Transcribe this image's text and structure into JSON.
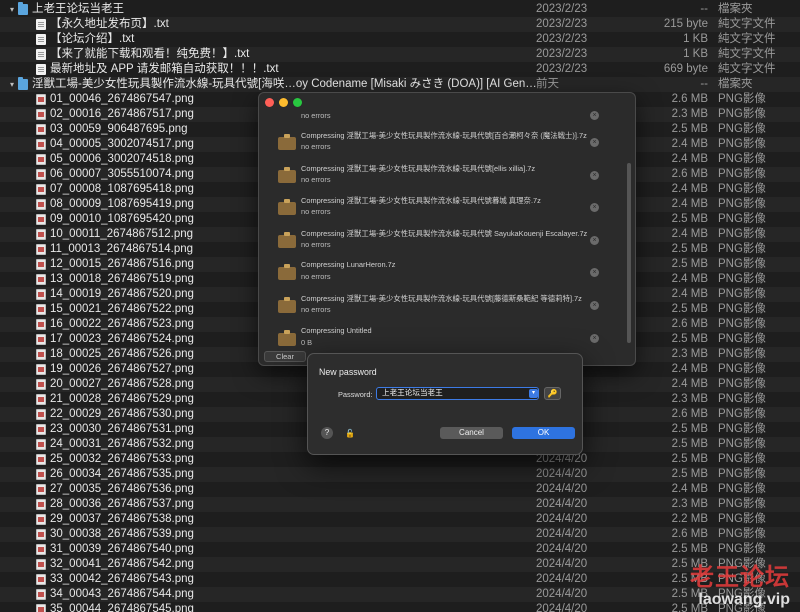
{
  "finder": {
    "rows": [
      {
        "disclosure": "▾",
        "icon": "folder",
        "indent": 0,
        "name": "上老王论坛当老王",
        "date": "2023/2/23",
        "size": "--",
        "kind": "檔案夾"
      },
      {
        "disclosure": "",
        "icon": "doc",
        "indent": 1,
        "name": "【永久地址发布页】.txt",
        "date": "2023/2/23",
        "size": "215 byte",
        "kind": "純文字文件"
      },
      {
        "disclosure": "",
        "icon": "doc",
        "indent": 1,
        "name": "【论坛介绍】.txt",
        "date": "2023/2/23",
        "size": "1 KB",
        "kind": "純文字文件"
      },
      {
        "disclosure": "",
        "icon": "doc",
        "indent": 1,
        "name": "【来了就能下载和观看！纯免费！】.txt",
        "date": "2023/2/23",
        "size": "1 KB",
        "kind": "純文字文件"
      },
      {
        "disclosure": "",
        "icon": "doc",
        "indent": 1,
        "name": "最新地址及 APP 请发邮箱自动获取！！！.txt",
        "date": "2023/2/23",
        "size": "669 byte",
        "kind": "純文字文件"
      },
      {
        "disclosure": "▾",
        "icon": "folder",
        "indent": 0,
        "name": "淫獸工場-美少女性玩具製作流水線-玩具代號[海咲…oy Codename [Misaki みさき (DOA)] [AI Generated]",
        "date": "前天",
        "size": "--",
        "kind": "檔案夾"
      },
      {
        "disclosure": "",
        "icon": "img",
        "indent": 1,
        "name": "01_00046_2674867547.png",
        "date": "",
        "size": "2.6 MB",
        "kind": "PNG影像"
      },
      {
        "disclosure": "",
        "icon": "img",
        "indent": 1,
        "name": "02_00016_2674867517.png",
        "date": "",
        "size": "2.3 MB",
        "kind": "PNG影像"
      },
      {
        "disclosure": "",
        "icon": "img",
        "indent": 1,
        "name": "03_00059_906487695.png",
        "date": "",
        "size": "2.5 MB",
        "kind": "PNG影像"
      },
      {
        "disclosure": "",
        "icon": "img",
        "indent": 1,
        "name": "04_00005_3002074517.png",
        "date": "",
        "size": "2.4 MB",
        "kind": "PNG影像"
      },
      {
        "disclosure": "",
        "icon": "img",
        "indent": 1,
        "name": "05_00006_3002074518.png",
        "date": "",
        "size": "2.4 MB",
        "kind": "PNG影像"
      },
      {
        "disclosure": "",
        "icon": "img",
        "indent": 1,
        "name": "06_00007_3055510074.png",
        "date": "",
        "size": "2.6 MB",
        "kind": "PNG影像"
      },
      {
        "disclosure": "",
        "icon": "img",
        "indent": 1,
        "name": "07_00008_1087695418.png",
        "date": "",
        "size": "2.4 MB",
        "kind": "PNG影像"
      },
      {
        "disclosure": "",
        "icon": "img",
        "indent": 1,
        "name": "08_00009_1087695419.png",
        "date": "",
        "size": "2.4 MB",
        "kind": "PNG影像"
      },
      {
        "disclosure": "",
        "icon": "img",
        "indent": 1,
        "name": "09_00010_1087695420.png",
        "date": "",
        "size": "2.5 MB",
        "kind": "PNG影像"
      },
      {
        "disclosure": "",
        "icon": "img",
        "indent": 1,
        "name": "10_00011_2674867512.png",
        "date": "",
        "size": "2.4 MB",
        "kind": "PNG影像"
      },
      {
        "disclosure": "",
        "icon": "img",
        "indent": 1,
        "name": "11_00013_2674867514.png",
        "date": "",
        "size": "2.5 MB",
        "kind": "PNG影像"
      },
      {
        "disclosure": "",
        "icon": "img",
        "indent": 1,
        "name": "12_00015_2674867516.png",
        "date": "",
        "size": "2.5 MB",
        "kind": "PNG影像"
      },
      {
        "disclosure": "",
        "icon": "img",
        "indent": 1,
        "name": "13_00018_2674867519.png",
        "date": "",
        "size": "2.4 MB",
        "kind": "PNG影像"
      },
      {
        "disclosure": "",
        "icon": "img",
        "indent": 1,
        "name": "14_00019_2674867520.png",
        "date": "",
        "size": "2.4 MB",
        "kind": "PNG影像"
      },
      {
        "disclosure": "",
        "icon": "img",
        "indent": 1,
        "name": "15_00021_2674867522.png",
        "date": "",
        "size": "2.5 MB",
        "kind": "PNG影像"
      },
      {
        "disclosure": "",
        "icon": "img",
        "indent": 1,
        "name": "16_00022_2674867523.png",
        "date": "",
        "size": "2.6 MB",
        "kind": "PNG影像"
      },
      {
        "disclosure": "",
        "icon": "img",
        "indent": 1,
        "name": "17_00023_2674867524.png",
        "date": "",
        "size": "2.5 MB",
        "kind": "PNG影像"
      },
      {
        "disclosure": "",
        "icon": "img",
        "indent": 1,
        "name": "18_00025_2674867526.png",
        "date": "",
        "size": "2.3 MB",
        "kind": "PNG影像"
      },
      {
        "disclosure": "",
        "icon": "img",
        "indent": 1,
        "name": "19_00026_2674867527.png",
        "date": "",
        "size": "2.4 MB",
        "kind": "PNG影像"
      },
      {
        "disclosure": "",
        "icon": "img",
        "indent": 1,
        "name": "20_00027_2674867528.png",
        "date": "",
        "size": "2.4 MB",
        "kind": "PNG影像"
      },
      {
        "disclosure": "",
        "icon": "img",
        "indent": 1,
        "name": "21_00028_2674867529.png",
        "date": "",
        "size": "2.3 MB",
        "kind": "PNG影像"
      },
      {
        "disclosure": "",
        "icon": "img",
        "indent": 1,
        "name": "22_00029_2674867530.png",
        "date": "",
        "size": "2.6 MB",
        "kind": "PNG影像"
      },
      {
        "disclosure": "",
        "icon": "img",
        "indent": 1,
        "name": "23_00030_2674867531.png",
        "date": "",
        "size": "2.5 MB",
        "kind": "PNG影像"
      },
      {
        "disclosure": "",
        "icon": "img",
        "indent": 1,
        "name": "24_00031_2674867532.png",
        "date": "",
        "size": "2.5 MB",
        "kind": "PNG影像"
      },
      {
        "disclosure": "",
        "icon": "img",
        "indent": 1,
        "name": "25_00032_2674867533.png",
        "date": "2024/4/20",
        "size": "2.5 MB",
        "kind": "PNG影像"
      },
      {
        "disclosure": "",
        "icon": "img",
        "indent": 1,
        "name": "26_00034_2674867535.png",
        "date": "2024/4/20",
        "size": "2.5 MB",
        "kind": "PNG影像"
      },
      {
        "disclosure": "",
        "icon": "img",
        "indent": 1,
        "name": "27_00035_2674867536.png",
        "date": "2024/4/20",
        "size": "2.4 MB",
        "kind": "PNG影像"
      },
      {
        "disclosure": "",
        "icon": "img",
        "indent": 1,
        "name": "28_00036_2674867537.png",
        "date": "2024/4/20",
        "size": "2.3 MB",
        "kind": "PNG影像"
      },
      {
        "disclosure": "",
        "icon": "img",
        "indent": 1,
        "name": "29_00037_2674867538.png",
        "date": "2024/4/20",
        "size": "2.2 MB",
        "kind": "PNG影像"
      },
      {
        "disclosure": "",
        "icon": "img",
        "indent": 1,
        "name": "30_00038_2674867539.png",
        "date": "2024/4/20",
        "size": "2.6 MB",
        "kind": "PNG影像"
      },
      {
        "disclosure": "",
        "icon": "img",
        "indent": 1,
        "name": "31_00039_2674867540.png",
        "date": "2024/4/20",
        "size": "2.5 MB",
        "kind": "PNG影像"
      },
      {
        "disclosure": "",
        "icon": "img",
        "indent": 1,
        "name": "32_00041_2674867542.png",
        "date": "2024/4/20",
        "size": "2.5 MB",
        "kind": "PNG影像"
      },
      {
        "disclosure": "",
        "icon": "img",
        "indent": 1,
        "name": "33_00042_2674867543.png",
        "date": "2024/4/20",
        "size": "2.5 MB",
        "kind": "PNG影像"
      },
      {
        "disclosure": "",
        "icon": "img",
        "indent": 1,
        "name": "34_00043_2674867544.png",
        "date": "2024/4/20",
        "size": "2.5 MB",
        "kind": "PNG影像"
      },
      {
        "disclosure": "",
        "icon": "img",
        "indent": 1,
        "name": "35_00044_2674867545.png",
        "date": "2024/4/20",
        "size": "2.5 MB",
        "kind": "PNG影像"
      }
    ]
  },
  "progress_window": {
    "tasks": [
      {
        "name": "",
        "status": "no errors"
      },
      {
        "name": "Compressing 淫獸工場-美少女性玩具製作流水線-玩具代號[百合瀬柯々奈 (魔法戦士)].7z",
        "status": "no errors"
      },
      {
        "name": "Compressing 淫獸工場-美少女性玩具製作流水線-玩具代號[ellis xillia].7z",
        "status": "no errors"
      },
      {
        "name": "Compressing 淫獸工場-美少女性玩具製作流水線-玩具代號暮城 真理奈.7z",
        "status": "no errors"
      },
      {
        "name": "Compressing 淫獸工場-美少女性玩具製作流水線-玩具代號 SayukaKouenji Escalayer.7z",
        "status": "no errors"
      },
      {
        "name": "Compressing LunarHeron.7z",
        "status": "no errors"
      },
      {
        "name": "Compressing 淫獸工場-美少女性玩具製作流水線-玩具代號[藤德斯桑範紀 等德莉特].7z",
        "status": "no errors"
      },
      {
        "name": "Compressing Untitled",
        "status": "0 B"
      }
    ],
    "clear_label": "Clear"
  },
  "password_dialog": {
    "title": "New password",
    "label": "Password:",
    "value": "上老王论坛当老王",
    "cancel_label": "Cancel",
    "ok_label": "OK",
    "help_label": "?"
  },
  "watermark": {
    "text": "老王论坛",
    "url": "laowang.vip"
  }
}
